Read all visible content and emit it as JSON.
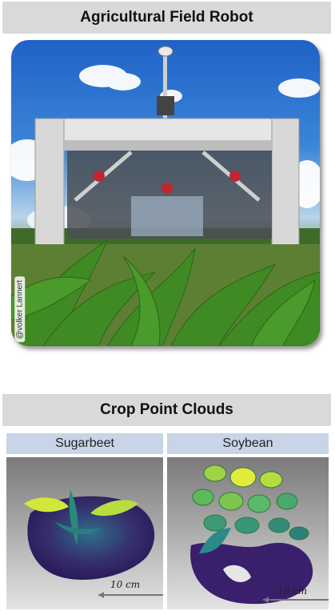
{
  "section1": {
    "title": "Agricultural Field Robot",
    "credit": "@volker Lannert"
  },
  "section2": {
    "title": "Crop Point Clouds",
    "panels": [
      {
        "label": "Sugarbeet",
        "scale": "10 cm"
      },
      {
        "label": "Soybean",
        "scale": "10 cm"
      }
    ]
  },
  "colors": {
    "banner_bg": "#d9d9d9",
    "panel_label_bg": "#c7d5e6",
    "pointcloud_low": "#3b1f6b",
    "pointcloud_mid": "#2a8a8a",
    "pointcloud_high": "#d9e83a"
  }
}
